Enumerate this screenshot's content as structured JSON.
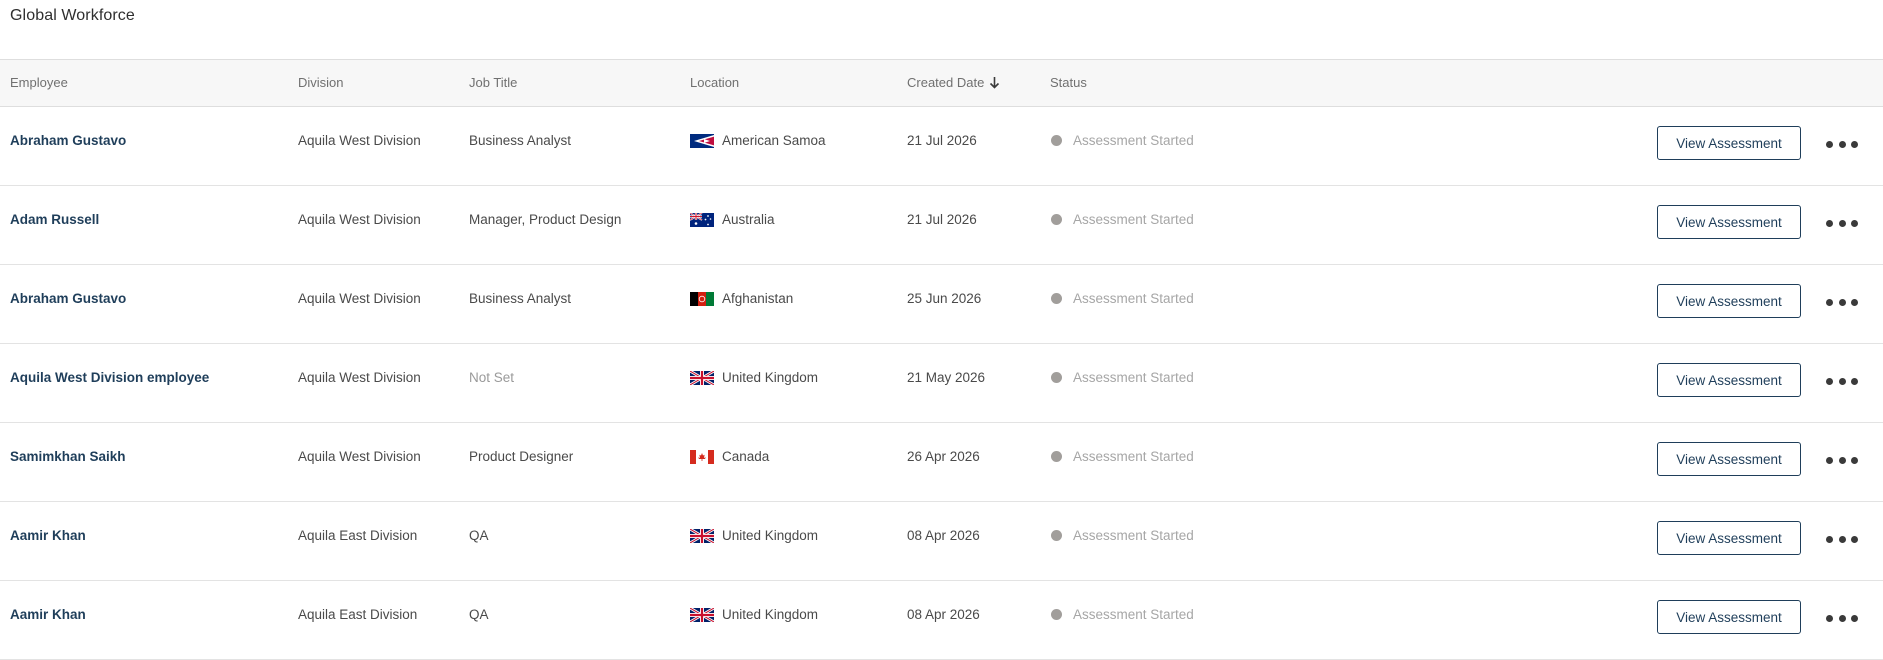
{
  "page_title": "Global Workforce",
  "columns": {
    "employee": "Employee",
    "division": "Division",
    "job_title": "Job Title",
    "location": "Location",
    "created_date": "Created Date",
    "status": "Status"
  },
  "sort": {
    "column": "created_date",
    "direction": "descending",
    "icon": "arrow-down-icon"
  },
  "action_label": "View Assessment",
  "more_icon": "more-horizontal-icon",
  "status_dot_color": "#a19e9b",
  "rows": [
    {
      "employee": "Abraham Gustavo",
      "division": "Aquila West Division",
      "job_title": "Business Analyst",
      "job_title_set": true,
      "flag": "american-samoa-flag-icon",
      "location": "American Samoa",
      "created_date": "21 Jul 2026",
      "status": "Assessment Started"
    },
    {
      "employee": "Adam Russell",
      "division": "Aquila West Division",
      "job_title": "Manager, Product Design",
      "job_title_set": true,
      "flag": "australia-flag-icon",
      "location": "Australia",
      "created_date": "21 Jul 2026",
      "status": "Assessment Started"
    },
    {
      "employee": "Abraham Gustavo",
      "division": "Aquila West Division",
      "job_title": "Business Analyst",
      "job_title_set": true,
      "flag": "afghanistan-flag-icon",
      "location": "Afghanistan",
      "created_date": "25 Jun 2026",
      "status": "Assessment Started"
    },
    {
      "employee": "Aquila West Division employee",
      "division": "Aquila West Division",
      "job_title": "Not Set",
      "job_title_set": false,
      "flag": "united-kingdom-flag-icon",
      "location": "United Kingdom",
      "created_date": "21 May 2026",
      "status": "Assessment Started"
    },
    {
      "employee": "Samimkhan Saikh",
      "division": "Aquila West Division",
      "job_title": "Product Designer",
      "job_title_set": true,
      "flag": "canada-flag-icon",
      "location": "Canada",
      "created_date": "26 Apr 2026",
      "status": "Assessment Started"
    },
    {
      "employee": "Aamir Khan",
      "division": "Aquila East Division",
      "job_title": "QA",
      "job_title_set": true,
      "flag": "united-kingdom-flag-icon",
      "location": "United Kingdom",
      "created_date": "08 Apr 2026",
      "status": "Assessment Started"
    },
    {
      "employee": "Aamir Khan",
      "division": "Aquila East Division",
      "job_title": "QA",
      "job_title_set": true,
      "flag": "united-kingdom-flag-icon",
      "location": "United Kingdom",
      "created_date": "08 Apr 2026",
      "status": "Assessment Started"
    }
  ]
}
